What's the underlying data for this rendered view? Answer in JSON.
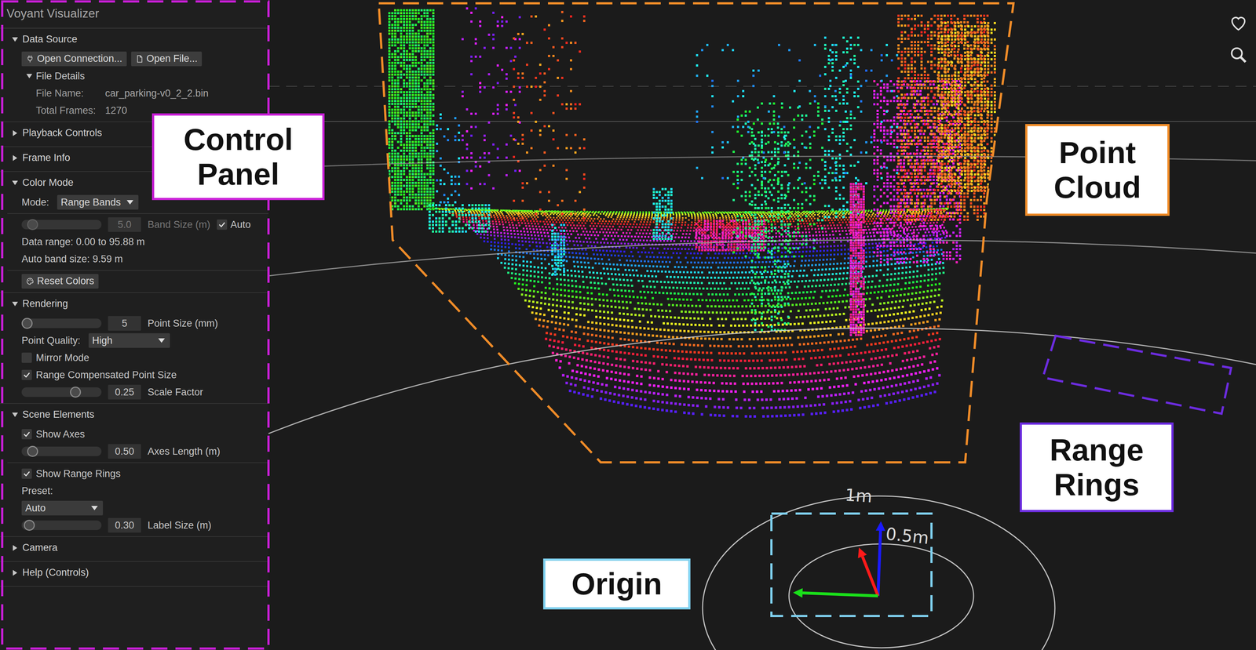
{
  "window": {
    "title": "Voyant Visualizer"
  },
  "control_panel": {
    "sections": [
      {
        "label": "Data Source",
        "expanded": true,
        "groups": [
          [
            {
              "kind": "buttons",
              "buttons": [
                {
                  "label": "Open Connection..."
                },
                {
                  "label": "Open File..."
                }
              ]
            },
            {
              "kind": "subsection",
              "label": "File Details",
              "expanded": true,
              "rows": [
                {
                  "kind": "field",
                  "label": "File Name:",
                  "value": "car_parking-v0_2_2.bin"
                },
                {
                  "kind": "field",
                  "label": "Total Frames:",
                  "value": "1270"
                }
              ]
            }
          ]
        ]
      },
      {
        "label": "Playback Controls",
        "expanded": false,
        "groups": []
      },
      {
        "label": "Frame Info",
        "expanded": false,
        "groups": []
      },
      {
        "label": "Color Mode",
        "expanded": true,
        "groups": [
          [
            {
              "kind": "select",
              "label": "Mode:",
              "value": "Range Bands"
            }
          ],
          [
            {
              "kind": "slider",
              "level": 0.08,
              "value": "5.0",
              "label": "Band Size (m)",
              "disabled": true,
              "toggle": {
                "label": "Auto",
                "checked": true
              }
            },
            {
              "kind": "text",
              "text": "Data range: 0.00 to 95.88 m"
            },
            {
              "kind": "text",
              "text": "Auto band size: 9.59 m"
            }
          ],
          [
            {
              "kind": "button",
              "label": "Reset Colors"
            }
          ]
        ]
      },
      {
        "label": "Rendering",
        "expanded": true,
        "groups": [
          [
            {
              "kind": "slider",
              "level": 0,
              "value": "5",
              "label": "Point Size (mm)",
              "disabled": false
            },
            {
              "kind": "select",
              "label": "Point Quality:",
              "value": "High"
            },
            {
              "kind": "checkbox",
              "label": "Mirror Mode",
              "checked": false
            },
            {
              "kind": "checkbox",
              "label": "Range Compensated Point Size",
              "checked": true
            },
            {
              "kind": "slider",
              "level": 0.7,
              "value": "0.25",
              "label": "Scale Factor",
              "disabled": false
            }
          ]
        ]
      },
      {
        "label": "Scene Elements",
        "expanded": true,
        "groups": [
          [
            {
              "kind": "checkbox",
              "label": "Show Axes",
              "checked": true
            },
            {
              "kind": "slider",
              "level": 0.08,
              "value": "0.50",
              "label": "Axes Length (m)",
              "disabled": false
            }
          ],
          [
            {
              "kind": "checkbox",
              "label": "Show Range Rings",
              "checked": true
            },
            {
              "kind": "text",
              "text": "Preset:"
            },
            {
              "kind": "select",
              "value": "Auto"
            },
            {
              "kind": "slider",
              "level": 0.03,
              "value": "0.30",
              "label": "Label Size (m)",
              "disabled": false
            }
          ]
        ]
      },
      {
        "label": "Camera",
        "expanded": false,
        "groups": []
      },
      {
        "label": "Help (Controls)",
        "expanded": false,
        "groups": []
      }
    ]
  },
  "viewport": {
    "ring_labels": [
      "1m",
      "0.5m"
    ]
  },
  "annotations": [
    {
      "label": "Control Panel",
      "color": "#c81ed6"
    },
    {
      "label": "Point Cloud",
      "color": "#f08c28"
    },
    {
      "label": "Range Rings",
      "color": "#6c2ce0"
    },
    {
      "label": "Origin",
      "color": "#7fd0ee"
    }
  ]
}
